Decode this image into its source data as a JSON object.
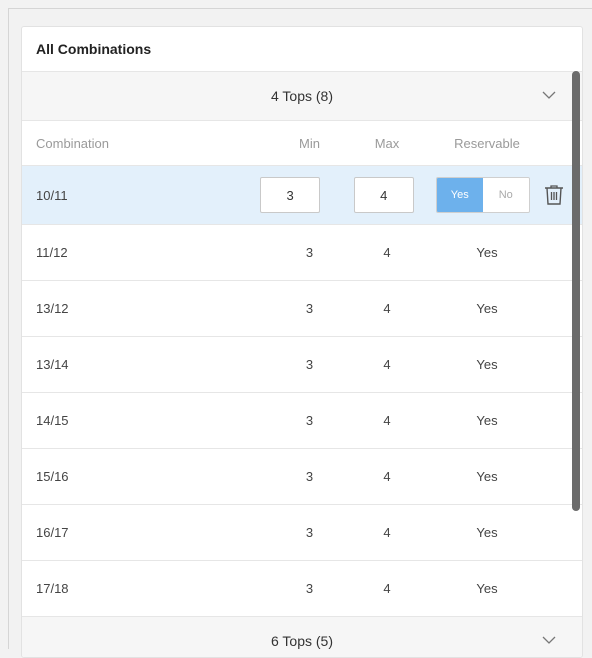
{
  "panel": {
    "title": "All Combinations"
  },
  "groups": [
    {
      "label": "4 Tops (8)"
    },
    {
      "label": "6 Tops (5)"
    }
  ],
  "columns": {
    "combination": "Combination",
    "min": "Min",
    "max": "Max",
    "reservable": "Reservable"
  },
  "selected_row": {
    "combination": "10/11",
    "min_value": "3",
    "max_value": "4",
    "toggle_yes": "Yes",
    "toggle_no": "No"
  },
  "rows": [
    {
      "combination": "11/12",
      "min": "3",
      "max": "4",
      "reservable": "Yes"
    },
    {
      "combination": "13/12",
      "min": "3",
      "max": "4",
      "reservable": "Yes"
    },
    {
      "combination": "13/14",
      "min": "3",
      "max": "4",
      "reservable": "Yes"
    },
    {
      "combination": "14/15",
      "min": "3",
      "max": "4",
      "reservable": "Yes"
    },
    {
      "combination": "15/16",
      "min": "3",
      "max": "4",
      "reservable": "Yes"
    },
    {
      "combination": "16/17",
      "min": "3",
      "max": "4",
      "reservable": "Yes"
    },
    {
      "combination": "17/18",
      "min": "3",
      "max": "4",
      "reservable": "Yes"
    }
  ],
  "icons": {
    "expand": "chevron-down-icon",
    "delete": "trash-icon"
  },
  "colors": {
    "selected_row_bg": "#e3f0fb",
    "toggle_active": "#6db1ec",
    "scrollbar": "#6b6b6b"
  }
}
